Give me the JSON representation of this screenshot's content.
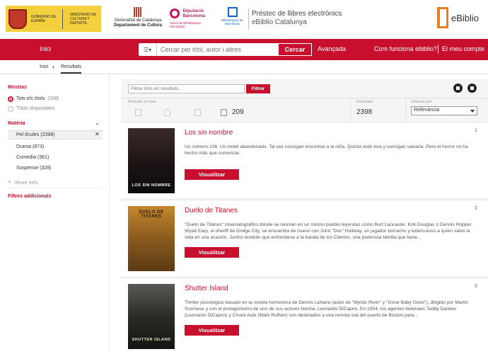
{
  "header": {
    "gov_text_1": "GOBIERNO DE ESPAÑA",
    "gov_text_2": "MINISTERIO DE CULTURA Y DEPORTE",
    "cat_line1": "Generalitat de Catalunya",
    "cat_line2": "Departament de Cultura",
    "dip_line1": "Diputació",
    "dip_line2": "Barcelona",
    "dip_sub": "Xarxa de Biblioteques Municipals",
    "bib_text": "Biblioteques de Barcelona",
    "site_title": "Préstec de llibres electrònics",
    "site_subtitle": "eBiblio Catalunya",
    "brand_text": "eBiblio"
  },
  "nav": {
    "home": "Inici",
    "search_placeholder": "Cercar per títol, autor i altres",
    "search_button": "Cercar",
    "advanced": "Avançada",
    "how_it_works": "Com funciona ebiblio?",
    "my_account": "El meu compte"
  },
  "breadcrumb": {
    "home": "Inici",
    "current": "Resultats"
  },
  "sidebar": {
    "show_title": "Mostras",
    "all_label": "Tots els títols",
    "all_count": "2398",
    "available_label": "Títols disponibles",
    "subject_title": "Matèria",
    "subjects": [
      {
        "label": "Pel·lícules (2398)"
      },
      {
        "label": "Drama (873)"
      },
      {
        "label": "Comedia (361)"
      },
      {
        "label": "Suspense (328)"
      }
    ],
    "more": "Veure més",
    "extra_filters": "Filtres addicionals"
  },
  "results": {
    "filter_placeholder": "Filtrar dins els resultats...",
    "filter_button": "Filtrar",
    "formats_label": "Formats en línia",
    "format_count": "209",
    "results_label": "Resultats",
    "results_count": "2398",
    "sort_label": "Ordenar per",
    "sort_value": "Rellevància",
    "items": [
      {
        "title": "Los sin nombre",
        "num": "1",
        "desc": "Un número:106. Un motel abandonado. Tal vez consigan encontrar a la niña. Quizás esté viva y consigan salvarla. Pero el horror no ha hecho más que comenzar.",
        "button": "Visualitzar",
        "poster_text": "LOS SIN NOMBRE"
      },
      {
        "title": "Duelo de Titanes",
        "num": "2",
        "desc": "\"Duelo de Titanes\" cinematográfico donde se reunían en un mismo pueblo leyendas como Burt Lancaster, Kirk Douglas o Dennis Hopper. Wyatt Earp, el sheriff de Dodge City, se encuentra de nuevo con John \"Doc\" Holliday, un jugador borracho y tuberculoso a quien salvó la vida en una ocasión. Juntos tendrán que enfrentarse a la banda de los Clanton, una poderosa familia que tiene...",
        "button": "Visualitzar",
        "poster_text": "DUELO DE TITANES"
      },
      {
        "title": "Shutter Island",
        "num": "3",
        "desc": "Thriller psicológico basado en la novela homónima de Dennis Lehane (autor de \"Mystic River\" y \"Gone Baby Gone\"), dirigido por Martin Scorsese y con el protagonismo de uno de sus actores fetiche, Leonardo DiCaprio. En 1954, los agentes federales Teddy Daniels (Leonardo DiCaprio) y Chuck Aule (Mark Ruffalo) son destinados a una remota isla del puerto de Boston para...",
        "button": "Visualitzar",
        "poster_text": "SHUTTER ISLAND"
      }
    ]
  },
  "colors": {
    "accent": "#c8102e",
    "brand_orange": "#e67e22"
  }
}
